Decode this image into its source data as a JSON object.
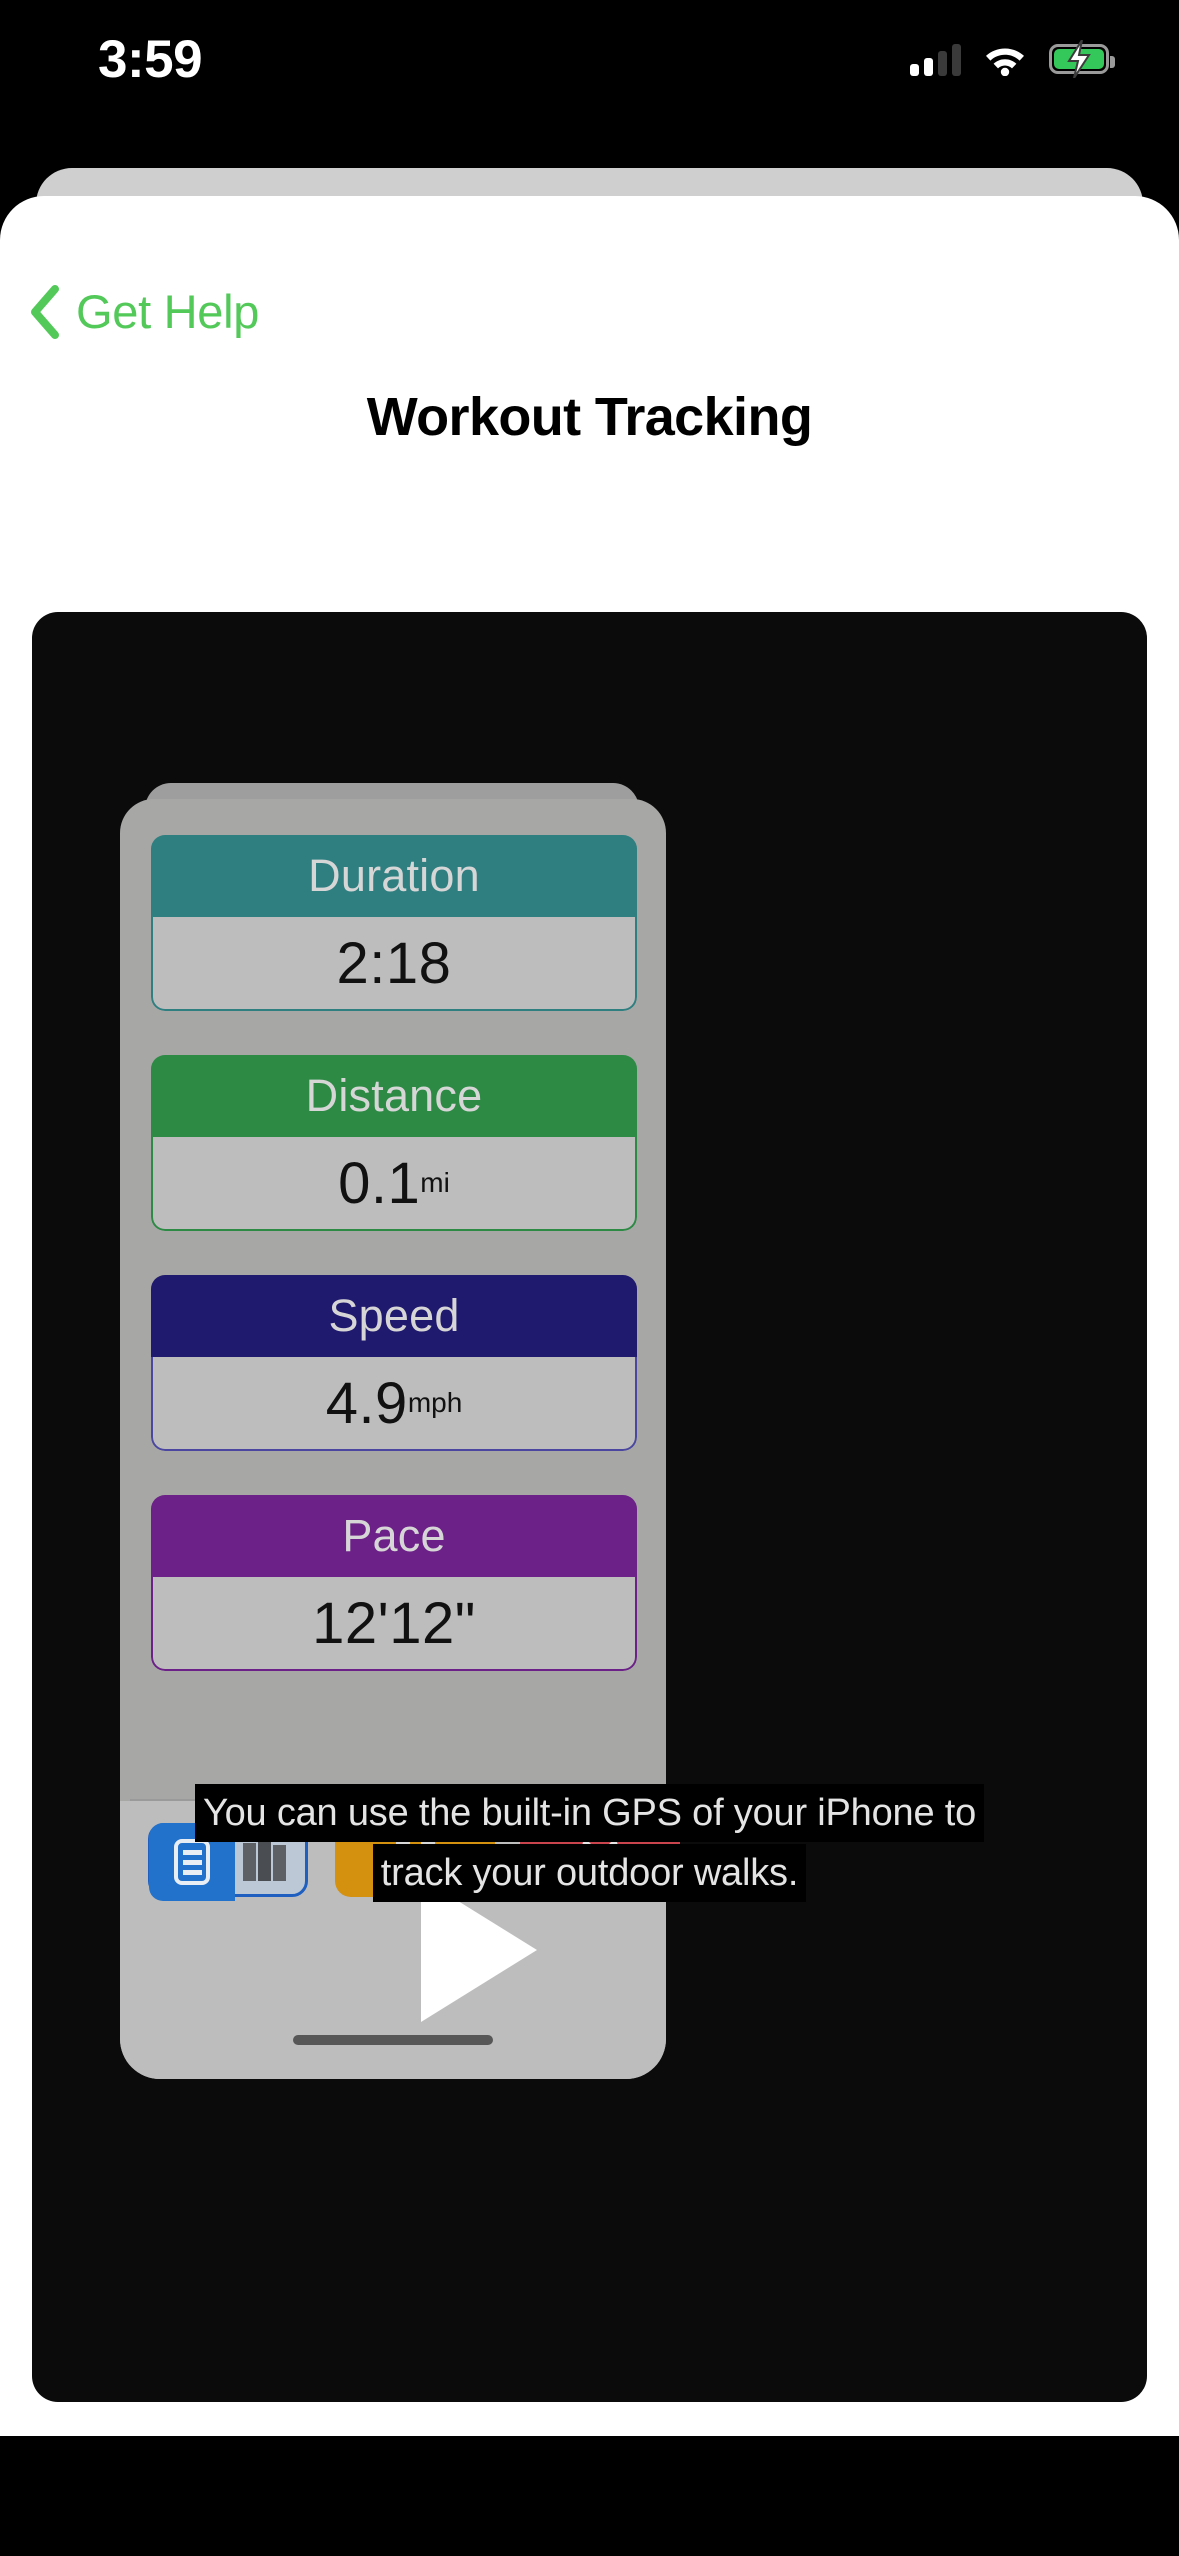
{
  "status_bar": {
    "time": "3:59",
    "cellular_icon": "cellular-bars-icon",
    "wifi_icon": "wifi-icon",
    "battery_icon": "battery-charging-icon",
    "battery_color": "#34c759"
  },
  "nav": {
    "back_label": "Get Help",
    "back_icon": "chevron-left-icon",
    "accent_color": "#53c95a"
  },
  "page": {
    "title": "Workout Tracking"
  },
  "video": {
    "play_icon": "play-triangle-icon",
    "captions": [
      "You can use the built-in GPS of your iPhone to",
      "track your outdoor walks."
    ]
  },
  "workout_metrics": [
    {
      "label": "Duration",
      "value": "2:18",
      "unit": "",
      "color": "#2f7f81"
    },
    {
      "label": "Distance",
      "value": "0.1",
      "unit": "mi",
      "color": "#2c8a45"
    },
    {
      "label": "Speed",
      "value": "4.9",
      "unit": "mph",
      "color": "#201a6e"
    },
    {
      "label": "Pace",
      "value": "12'12\"",
      "unit": "",
      "color": "#6c2188"
    }
  ],
  "mock_toolbar": {
    "list_button_icon": "list-document-icon",
    "list_button_icon_2": "building-icon",
    "pause_button_icon": "pause-icon",
    "close_button_icon": "close-x-icon",
    "list_color": "#2272cc",
    "pause_color": "#d4900f",
    "close_color": "#c9444c"
  }
}
